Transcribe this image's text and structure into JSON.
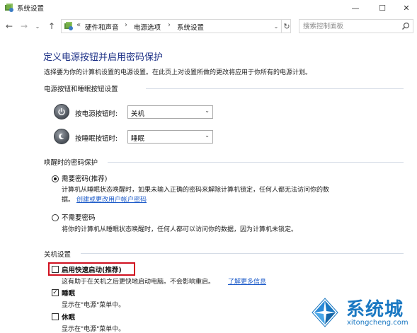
{
  "window": {
    "title": "系统设置",
    "controls": {
      "minimize": "—",
      "maximize": "☐",
      "close": "✕"
    }
  },
  "nav": {
    "back": "←",
    "forward": "→",
    "dropdown": "⌄",
    "up": "↑"
  },
  "address": {
    "overflow": "«",
    "crumbs": [
      "硬件和声音",
      "电源选项",
      "系统设置"
    ],
    "separator": "›",
    "dropdown": "⌄",
    "refresh": "↻"
  },
  "search": {
    "placeholder": "搜索控制面板"
  },
  "page": {
    "title": "定义电源按钮并启用密码保护",
    "description": "选择要为你的计算机设置的电源设置。在此页上对设置所做的更改将应用于你所有的电源计划。"
  },
  "power_buttons": {
    "heading": "电源按钮和睡眠按钮设置",
    "power_label": "按电源按钮时:",
    "power_value": "关机",
    "sleep_label": "按睡眠按钮时:",
    "sleep_value": "睡眠",
    "arrow": "⌄"
  },
  "wake_password": {
    "heading": "唤醒时的密码保护",
    "require": {
      "label": "需要密码(推荐)",
      "desc": "计算机从睡眠状态唤醒时，如果未输入正确的密码来解除计算机锁定，任何人都无法访问你的数",
      "desc2": "据。",
      "link": "创建或更改用户帐户密码",
      "selected": true
    },
    "no_require": {
      "label": "不需要密码",
      "desc": "将你的计算机从睡眠状态唤醒时，任何人都可以访问你的数据，因为计算机未锁定。",
      "selected": false
    }
  },
  "shutdown": {
    "heading": "关机设置",
    "fast_startup": {
      "label": "启用快速启动(推荐)",
      "desc": "这有助于在关机之后更快地启动电脑。不会影响重启。",
      "link": "了解更多信息",
      "checked": false
    },
    "sleep": {
      "label": "睡眠",
      "desc": "显示在\"电源\"菜单中。",
      "checked": true,
      "mark": "✓"
    },
    "hibernate": {
      "label": "休眠",
      "desc": "显示在\"电源\"菜单中。",
      "checked": false
    }
  },
  "watermark": {
    "name": "系统城",
    "url": "xitongcheng.com"
  }
}
